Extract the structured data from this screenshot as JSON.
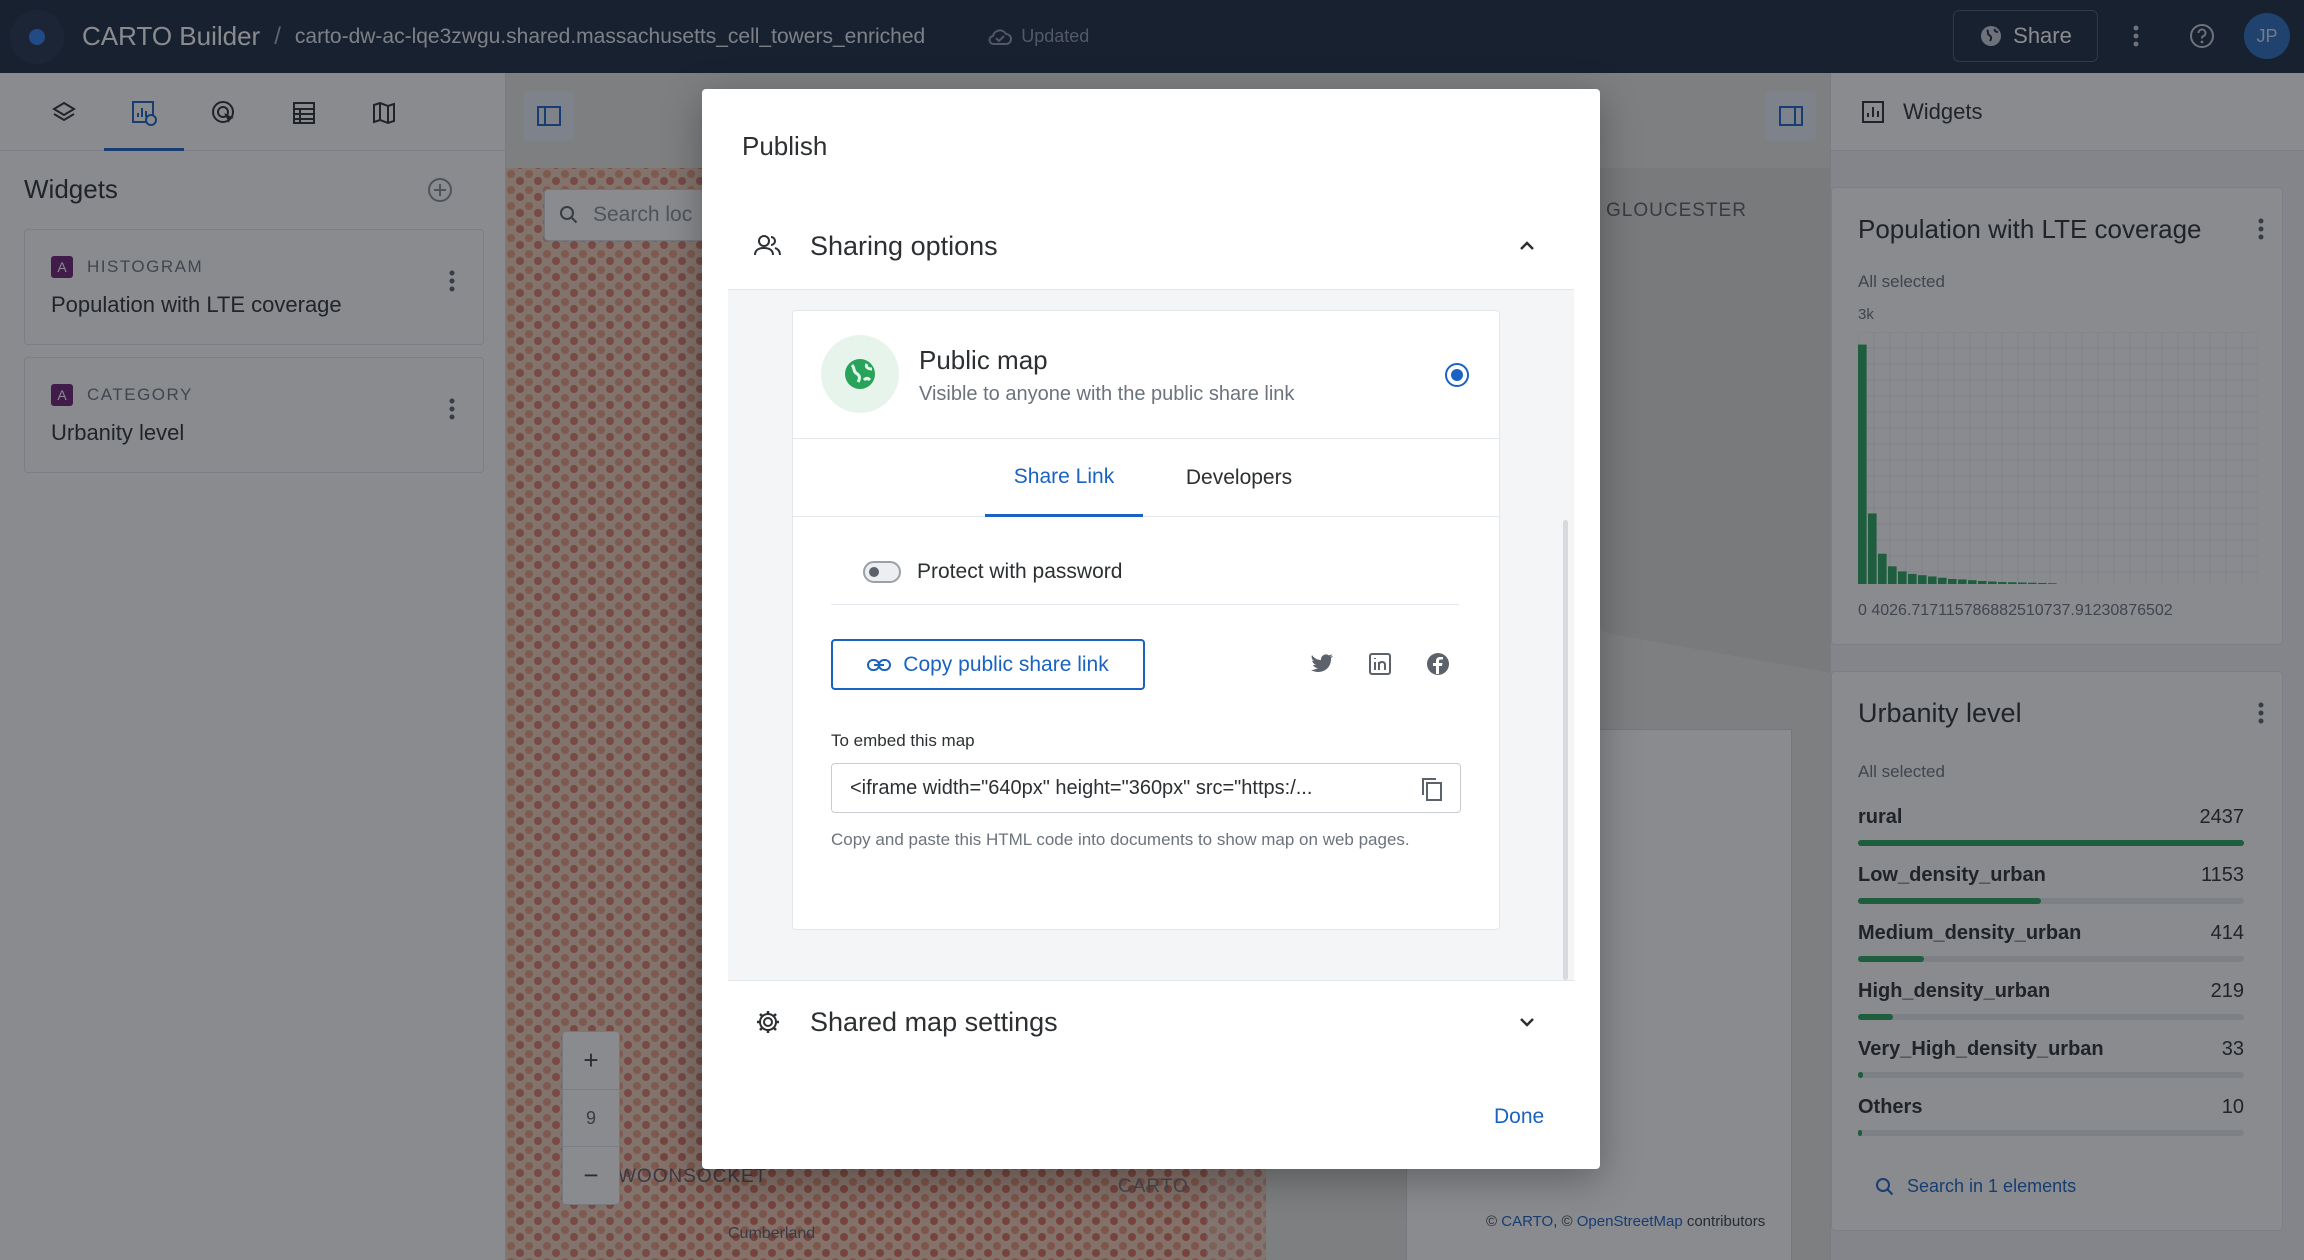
{
  "topbar": {
    "app_title": "CARTO Builder",
    "separator": "/",
    "dataset": "carto-dw-ac-lqe3zwgu.shared.massachusetts_cell_towers_enriched",
    "status": "Updated",
    "share_label": "Share",
    "avatar_initials": "JP"
  },
  "left_panel": {
    "title": "Widgets",
    "widgets": [
      {
        "type_badge": "A",
        "type": "HISTOGRAM",
        "name": "Population with LTE coverage"
      },
      {
        "type_badge": "A",
        "type": "CATEGORY",
        "name": "Urbanity level"
      }
    ]
  },
  "map": {
    "search_placeholder": "Search loc",
    "zoom_level": "9",
    "zoom_in": "+",
    "zoom_out": "−",
    "labels": {
      "gloucester": "GLOUCESTER",
      "woonsocket": "WOONSOCKET",
      "cumberland": "Cumberland",
      "carto": "CARTO"
    },
    "attribution": {
      "prefix": "© ",
      "carto": "CARTO",
      "mid": ", © ",
      "osm": "OpenStreetMap",
      "suffix": " contributors"
    }
  },
  "right_panel": {
    "header": "Widgets",
    "histogram": {
      "title": "Population with LTE coverage",
      "subtitle": "All selected",
      "y_tick": "3k",
      "x_axis_text": "0 4026.717115786882510737.91230876502",
      "bars": [
        0.95,
        0.28,
        0.12,
        0.07,
        0.05,
        0.04,
        0.035,
        0.03,
        0.025,
        0.02,
        0.018,
        0.015,
        0.012,
        0.01,
        0.008,
        0.007,
        0.006,
        0.005,
        0.004,
        0.003
      ]
    },
    "category": {
      "title": "Urbanity level",
      "subtitle": "All selected",
      "max": 2437,
      "rows": [
        {
          "label": "rural",
          "value": "2437",
          "num": 2437
        },
        {
          "label": "Low_density_urban",
          "value": "1153",
          "num": 1153
        },
        {
          "label": "Medium_density_urban",
          "value": "414",
          "num": 414
        },
        {
          "label": "High_density_urban",
          "value": "219",
          "num": 219
        },
        {
          "label": "Very_High_density_urban",
          "value": "33",
          "num": 33
        },
        {
          "label": "Others",
          "value": "10",
          "num": 10
        }
      ],
      "search_label": "Search in 1 elements"
    }
  },
  "modal": {
    "title": "Publish",
    "sharing_options": "Sharing options",
    "public_map_title": "Public map",
    "public_map_sub": "Visible to anyone with the public share link",
    "tabs": [
      "Share Link",
      "Developers"
    ],
    "protect_label": "Protect with password",
    "copy_link_label": "Copy public share link",
    "embed_label": "To embed this map",
    "embed_code": "<iframe width=\"640px\" height=\"360px\" src=\"https:/...",
    "embed_help": "Copy and paste this HTML code into documents to show map on web pages.",
    "shared_settings": "Shared map settings",
    "done_label": "Done"
  },
  "colors": {
    "topbar_bg": "#1d2a3f",
    "accent": "#1a63c2",
    "histogram_green": "#28a35a",
    "badge_purple": "#6e1f73"
  }
}
